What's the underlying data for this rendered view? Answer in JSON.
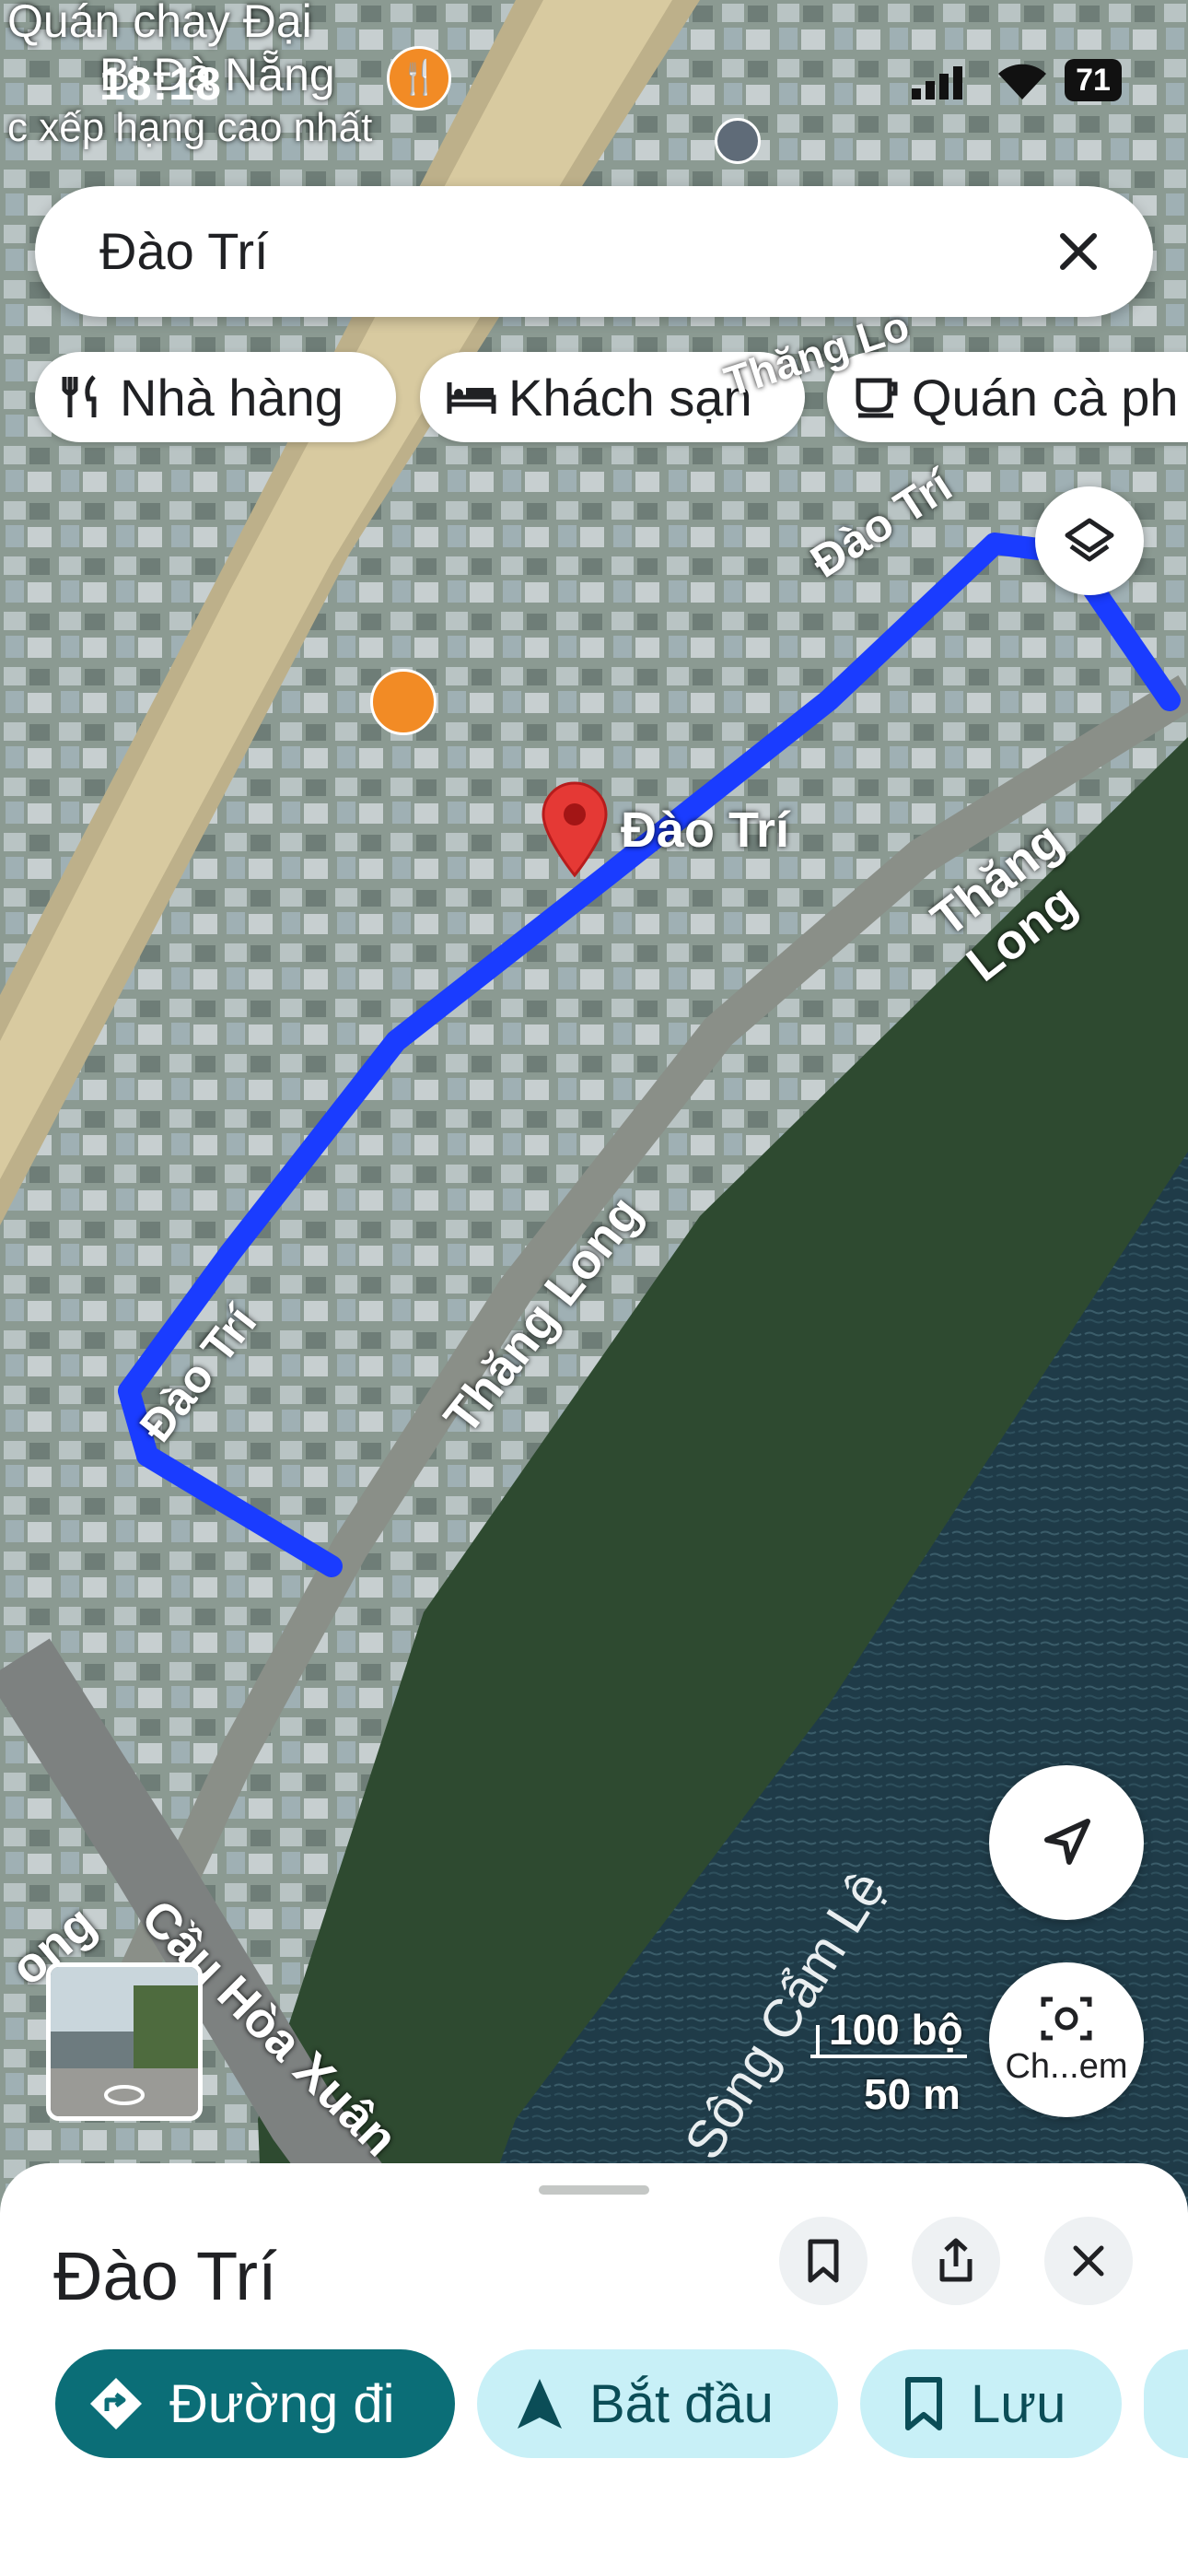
{
  "status_bar": {
    "time": "18:18",
    "battery": "71"
  },
  "search": {
    "query": "Đào Trí"
  },
  "chips": [
    {
      "label": "Nhà hàng",
      "icon": "restaurant-icon"
    },
    {
      "label": "Khách sạn",
      "icon": "hotel-icon"
    },
    {
      "label": "Quán cà ph",
      "icon": "cafe-icon"
    }
  ],
  "map": {
    "poi_label_line1": "Quán chay Đại",
    "poi_label_line2": "Bi Đà Nẵng",
    "poi_label_line3": "c xếp hạng cao nhất",
    "pin_label": "Đào Trí",
    "road_labels": {
      "dao_tri_top": "Đào Trí",
      "dao_tri_left": "Đào Trí",
      "thang_long_right": "Thăng Long",
      "thang_long_mid": "Thăng Long",
      "thang_long_top": "Thăng Lo",
      "cau_hoa_xuan": "Cầu Hòa Xuân",
      "ong": "ong",
      "river": "Sông Cẩm Lệ"
    },
    "scale_top": "100 bộ",
    "scale_bottom": "50 m",
    "lens_label": "Ch...em"
  },
  "sheet": {
    "title": "Đào Trí",
    "actions": [
      {
        "label": "Đường đi",
        "icon": "directions-icon"
      },
      {
        "label": "Bắt đầu",
        "icon": "navigation-arrow-icon"
      },
      {
        "label": "Lưu",
        "icon": "bookmark-icon"
      }
    ]
  },
  "colors": {
    "route": "#1a3cff",
    "pin": "#e53935",
    "primary": "#0b6e77",
    "secondary": "#c8f0f7"
  }
}
